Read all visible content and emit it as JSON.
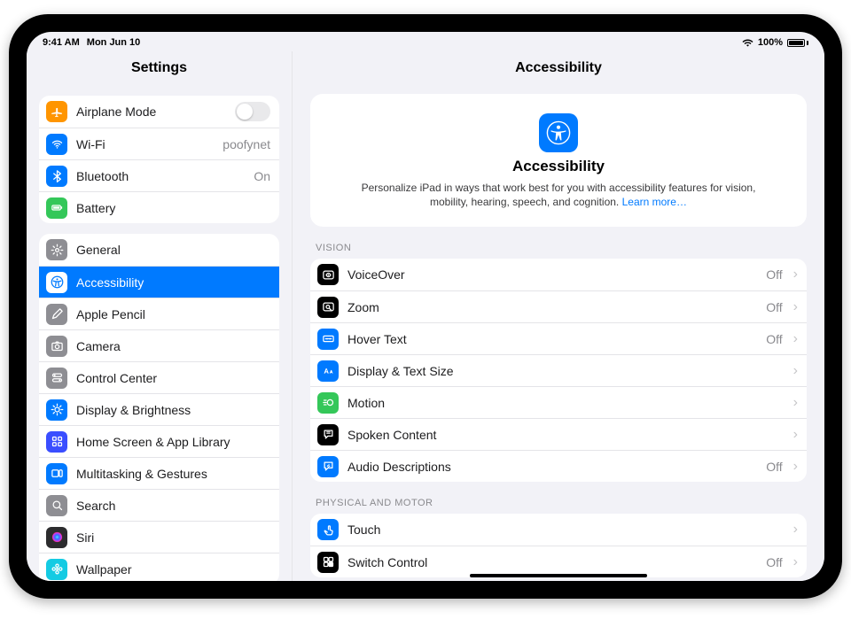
{
  "status": {
    "time": "9:41 AM",
    "date": "Mon Jun 10",
    "battery": "100%"
  },
  "sidebar": {
    "title": "Settings",
    "groups": [
      {
        "rows": [
          {
            "id": "airplane",
            "name": "airplane-mode",
            "label": "Airplane Mode",
            "type": "toggle",
            "iconBg": "#ff9500",
            "icon": "plane"
          },
          {
            "id": "wifi",
            "name": "wifi",
            "label": "Wi-Fi",
            "value": "poofynet",
            "iconBg": "#007aff",
            "icon": "wifi"
          },
          {
            "id": "bluetooth",
            "name": "bluetooth",
            "label": "Bluetooth",
            "value": "On",
            "iconBg": "#007aff",
            "icon": "bluetooth"
          },
          {
            "id": "battery",
            "name": "battery",
            "label": "Battery",
            "iconBg": "#34c759",
            "icon": "battery"
          }
        ]
      },
      {
        "rows": [
          {
            "id": "general",
            "name": "general",
            "label": "General",
            "iconBg": "#8e8e93",
            "icon": "gear"
          },
          {
            "id": "accessibility",
            "name": "accessibility",
            "label": "Accessibility",
            "iconBg": "#007aff",
            "icon": "access",
            "selected": true
          },
          {
            "id": "applepencil",
            "name": "apple-pencil",
            "label": "Apple Pencil",
            "iconBg": "#8e8e93",
            "icon": "pencil"
          },
          {
            "id": "camera",
            "name": "camera",
            "label": "Camera",
            "iconBg": "#8e8e93",
            "icon": "camera"
          },
          {
            "id": "controlcenter",
            "name": "control-center",
            "label": "Control Center",
            "iconBg": "#8e8e93",
            "icon": "switches"
          },
          {
            "id": "display",
            "name": "display-brightness",
            "label": "Display & Brightness",
            "iconBg": "#007aff",
            "icon": "sun"
          },
          {
            "id": "homescreen",
            "name": "home-screen-app-library",
            "label": "Home Screen & App Library",
            "iconBg": "#3a4eff",
            "icon": "grid"
          },
          {
            "id": "multitask",
            "name": "multitasking-gestures",
            "label": "Multitasking & Gestures",
            "iconBg": "#007aff",
            "icon": "multitask"
          },
          {
            "id": "search",
            "name": "search",
            "label": "Search",
            "iconBg": "#8e8e93",
            "icon": "search"
          },
          {
            "id": "siri",
            "name": "siri",
            "label": "Siri",
            "iconBg": "#2c2c2e",
            "icon": "siri"
          },
          {
            "id": "wallpaper",
            "name": "wallpaper",
            "label": "Wallpaper",
            "iconBg": "#14cbe3",
            "icon": "flower"
          }
        ]
      }
    ]
  },
  "main": {
    "title": "Accessibility",
    "hero": {
      "title": "Accessibility",
      "text": "Personalize iPad in ways that work best for you with accessibility features for vision, mobility, hearing, speech, and cognition.",
      "link": "Learn more…"
    },
    "sections": [
      {
        "label": "Vision",
        "rows": [
          {
            "name": "voiceover",
            "label": "VoiceOver",
            "value": "Off",
            "iconBg": "#000000",
            "icon": "voiceover"
          },
          {
            "name": "zoom",
            "label": "Zoom",
            "value": "Off",
            "iconBg": "#000000",
            "icon": "zoom"
          },
          {
            "name": "hover-text",
            "label": "Hover Text",
            "value": "Off",
            "iconBg": "#007aff",
            "icon": "hover"
          },
          {
            "name": "display-text-size",
            "label": "Display & Text Size",
            "value": "",
            "iconBg": "#007aff",
            "icon": "textsize"
          },
          {
            "name": "motion",
            "label": "Motion",
            "value": "",
            "iconBg": "#34c759",
            "icon": "motion"
          },
          {
            "name": "spoken-content",
            "label": "Spoken Content",
            "value": "",
            "iconBg": "#000000",
            "icon": "speech"
          },
          {
            "name": "audio-descriptions",
            "label": "Audio Descriptions",
            "value": "Off",
            "iconBg": "#007aff",
            "icon": "audiodesc"
          }
        ]
      },
      {
        "label": "Physical and Motor",
        "rows": [
          {
            "name": "touch",
            "label": "Touch",
            "value": "",
            "iconBg": "#007aff",
            "icon": "touch"
          },
          {
            "name": "switch-control",
            "label": "Switch Control",
            "value": "Off",
            "iconBg": "#000000",
            "icon": "switchctl"
          }
        ]
      }
    ]
  }
}
